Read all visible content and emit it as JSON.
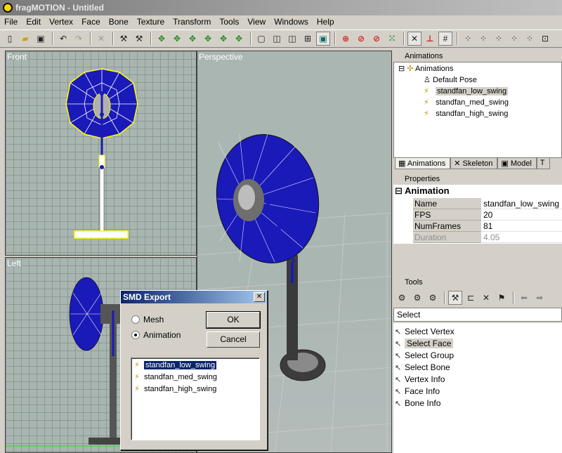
{
  "window": {
    "title": "fragMOTION - Untitled"
  },
  "menu": [
    "File",
    "Edit",
    "Vertex",
    "Face",
    "Bone",
    "Texture",
    "Transform",
    "Tools",
    "View",
    "Windows",
    "Help"
  ],
  "toolbar": {
    "icons": [
      "new-icon",
      "open-icon",
      "save-icon",
      "undo-icon",
      "redo-icon",
      "delete-icon",
      "bone-tool-icon",
      "bone-delete-icon",
      "move-x-icon",
      "move-y-icon",
      "move-z-icon",
      "move-xy-icon",
      "move-yz-icon",
      "move-xz-icon",
      "view-single-icon",
      "view-double-icon",
      "view-triple-icon",
      "view-quad-icon",
      "view-textured-icon",
      "select-cursor-icon",
      "texture-toggle-icon",
      "wireframe-toggle-icon",
      "vertex-toggle-icon",
      "bone-view-icon",
      "axis-icon",
      "grid-icon",
      "snap1-icon",
      "snap2-icon",
      "snap3-icon",
      "snap4-icon",
      "snap5-icon",
      "more-icon"
    ]
  },
  "viewports": {
    "front": "Front",
    "perspective": "Perspective",
    "left": "Left"
  },
  "animations_panel": {
    "header": "Animations",
    "root": "Animations",
    "items": [
      "Default Pose",
      "standfan_low_swing",
      "standfan_med_swing",
      "standfan_high_swing"
    ],
    "selected": "standfan_low_swing"
  },
  "tabs": [
    "Animations",
    "Skeleton",
    "Model",
    "T"
  ],
  "properties_panel": {
    "header": "Properties",
    "section": "Animation",
    "rows": [
      {
        "name": "Name",
        "value": "standfan_low_swing"
      },
      {
        "name": "FPS",
        "value": "20"
      },
      {
        "name": "NumFrames",
        "value": "81"
      },
      {
        "name": "Duration",
        "value": "4.05"
      }
    ]
  },
  "tools_panel": {
    "header": "Tools",
    "mode": "Select",
    "items": [
      "Select Vertex",
      "Select Face",
      "Select Group",
      "Select Bone",
      "Vertex Info",
      "Face Info",
      "Bone Info"
    ],
    "selected": "Select Face"
  },
  "dialog": {
    "title": "SMD Export",
    "close": "✕",
    "options": [
      "Mesh",
      "Animation"
    ],
    "selected_option": "Animation",
    "ok": "OK",
    "cancel": "Cancel",
    "list": [
      "standfan_low_swing",
      "standfan_med_swing",
      "standfan_high_swing"
    ],
    "selected_item": "standfan_low_swing"
  },
  "colors": {
    "mesh_blue": "#1a1ab8",
    "selection_yellow": "#ffff00",
    "dialog_title": "#0a246a"
  }
}
